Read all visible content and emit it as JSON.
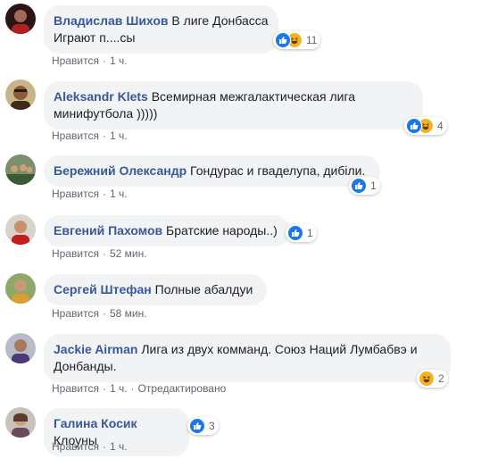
{
  "like_label": "Нравится",
  "separator": "·",
  "colors": {
    "author": "#385898",
    "bubble": "#f2f3f5",
    "like": "#1877f2",
    "haha": "#f7b125",
    "meta": "#606770"
  },
  "comments": [
    {
      "author": "Владислав Шихов",
      "text": "В лиге Донбасса Играют п....сы",
      "time": "1 ч.",
      "reactions": [
        "like-icon",
        "haha-icon"
      ],
      "count": "11",
      "edited": ""
    },
    {
      "author": "Aleksandr Klets",
      "text": "Всемирная межгалактическая лига минифутбола )))))",
      "time": "1 ч.",
      "reactions": [
        "like-icon",
        "haha-icon"
      ],
      "count": "4",
      "edited": ""
    },
    {
      "author": "Бережний Олександр",
      "text": "Гондурас и гваделупа, дибіли.",
      "time": "1 ч.",
      "reactions": [
        "like-icon"
      ],
      "count": "1",
      "edited": ""
    },
    {
      "author": "Евгений Пахомов",
      "text": "Братские народы..)",
      "time": "52 мин.",
      "reactions": [
        "like-icon"
      ],
      "count": "1",
      "edited": ""
    },
    {
      "author": "Сергей Штефан",
      "text": "Полные абалдуи",
      "time": "58 мин.",
      "reactions": [],
      "count": "",
      "edited": ""
    },
    {
      "author": "Jackie Airman",
      "text": "Лига из двух комманд. Союз Наций Лумбабвэ и Донбанды.",
      "time": "1 ч.",
      "reactions": [
        "haha-icon"
      ],
      "count": "2",
      "edited": "Отредактировано"
    },
    {
      "author": "Галина Косик",
      "text": "Клоуны",
      "time": "1 ч.",
      "reactions": [
        "like-icon"
      ],
      "count": "3",
      "edited": ""
    }
  ]
}
